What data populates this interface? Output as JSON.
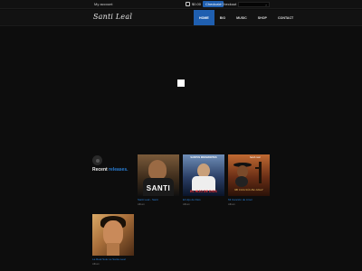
{
  "topbar": {
    "account_label": "My account",
    "cart_total": "$0.00",
    "cart_checkout_label": "Checkout",
    "checkout_label": "Checkout",
    "search_placeholder": ""
  },
  "header": {
    "logo_text": "Santi Leal",
    "nav": [
      {
        "label": "HOME",
        "active": true
      },
      {
        "label": "BIO",
        "active": false
      },
      {
        "label": "MUSIC",
        "active": false
      },
      {
        "label": "SHOP",
        "active": false
      },
      {
        "label": "CONTACT",
        "active": false
      }
    ]
  },
  "section": {
    "title_main": "Recent",
    "title_accent": "releases."
  },
  "releases": [
    {
      "title": "Santi Leal - Santi",
      "meta": "Album",
      "cover_text": "SANTI"
    },
    {
      "title": "El Hijo de Dios",
      "meta": "Album",
      "cover_text": "EL HIJO DE DIOS",
      "cover_top_text": "SANTOS MIRAMONTES"
    },
    {
      "title": "Mi Canción de Amor",
      "meta": "Album",
      "cover_text": "Mi Canción De Amor",
      "cover_top_text": "Santi Leal"
    },
    {
      "title": "La Real Sole La Santa Leal",
      "meta": "Album"
    }
  ],
  "colors": {
    "accent": "#1f5fb0",
    "link": "#2a7fd6",
    "background": "#0d0d0d"
  }
}
